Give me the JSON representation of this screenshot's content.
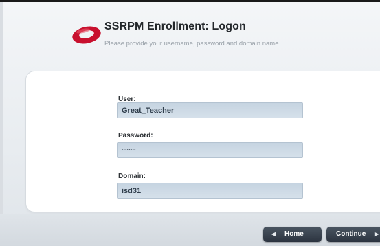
{
  "header": {
    "title": "SSRPM Enrollment: Logon",
    "subtitle": "Please provide your username, password and domain name."
  },
  "form": {
    "user": {
      "label": "User:",
      "value": "Great_Teacher"
    },
    "password": {
      "label": "Password:",
      "value": "••••••••"
    },
    "domain": {
      "label": "Domain:",
      "value": "isd31"
    }
  },
  "buttons": {
    "home": {
      "label": "Home",
      "icon": "chevron-left-icon"
    },
    "continue": {
      "label": "Continue",
      "icon": "chevron-right-icon"
    }
  },
  "colors": {
    "accent": "#c8102e",
    "field_bg": "#ccd8e4",
    "button_bg": "#343d48"
  }
}
